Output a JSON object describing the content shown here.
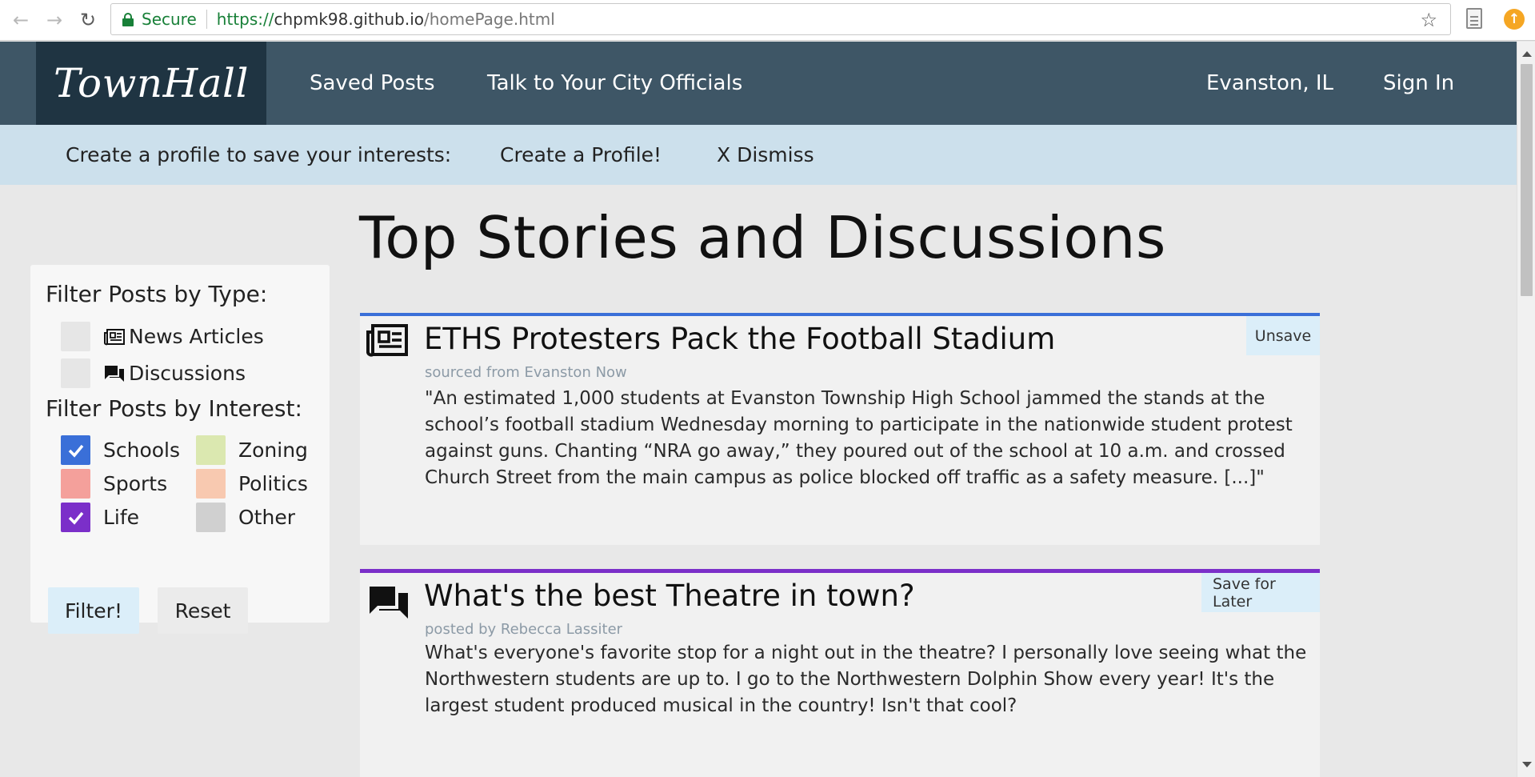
{
  "browser": {
    "secure_label": "Secure",
    "url_scheme": "https://",
    "url_host": "chpmk98.github.io",
    "url_path": "/homePage.html"
  },
  "navbar": {
    "brand": "TownHall",
    "links": [
      "Saved Posts",
      "Talk to Your City Officials"
    ],
    "location": "Evanston, IL",
    "sign_in": "Sign In"
  },
  "banner": {
    "prompt": "Create a profile to save your interests:",
    "create": "Create a Profile!",
    "dismiss": "X Dismiss"
  },
  "page_title": "Top Stories and Discussions",
  "filters": {
    "type_title": "Filter Posts by Type:",
    "types": [
      {
        "label": "News Articles",
        "icon": "newspaper-icon",
        "checked": false
      },
      {
        "label": "Discussions",
        "icon": "discussion-icon",
        "checked": false
      }
    ],
    "interest_title": "Filter Posts by Interest:",
    "interests": [
      {
        "label": "Schools",
        "color": "#3a6fd8",
        "checked": true
      },
      {
        "label": "Zoning",
        "color": "#dbe8b0",
        "checked": false
      },
      {
        "label": "Sports",
        "color": "#f4a09b",
        "checked": false
      },
      {
        "label": "Politics",
        "color": "#f8c9b0",
        "checked": false
      },
      {
        "label": "Life",
        "color": "#7b2fc9",
        "checked": true
      },
      {
        "label": "Other",
        "color": "#d0d0d0",
        "checked": false
      }
    ],
    "filter_button": "Filter!",
    "reset_button": "Reset"
  },
  "posts": [
    {
      "title": "ETHS Protesters Pack the Football Stadium",
      "source": "sourced from Evanston Now",
      "body": "\"An estimated 1,000 students at Evanston Township High School jammed the stands at the school’s football stadium Wednesday morning to participate in the nationwide student protest against guns. Chanting “NRA go away,” they poured out of the school at 10 a.m. and crossed Church Street from the main campus as police blocked off traffic as a safety measure. [...]\"",
      "action": "Unsave",
      "icon": "newspaper-icon",
      "accent": "#3a6fd8"
    },
    {
      "title": "What's the best Theatre in town?",
      "source": "posted by Rebecca Lassiter",
      "body": "What's everyone's favorite stop for a night out in the theatre? I personally love seeing what the Northwestern students are up to. I go to the Northwestern Dolphin Show every year! It's the largest student produced musical in the country! Isn't that cool?",
      "action": "Save for Later",
      "icon": "discussion-icon",
      "accent": "#7b2fc9"
    }
  ]
}
